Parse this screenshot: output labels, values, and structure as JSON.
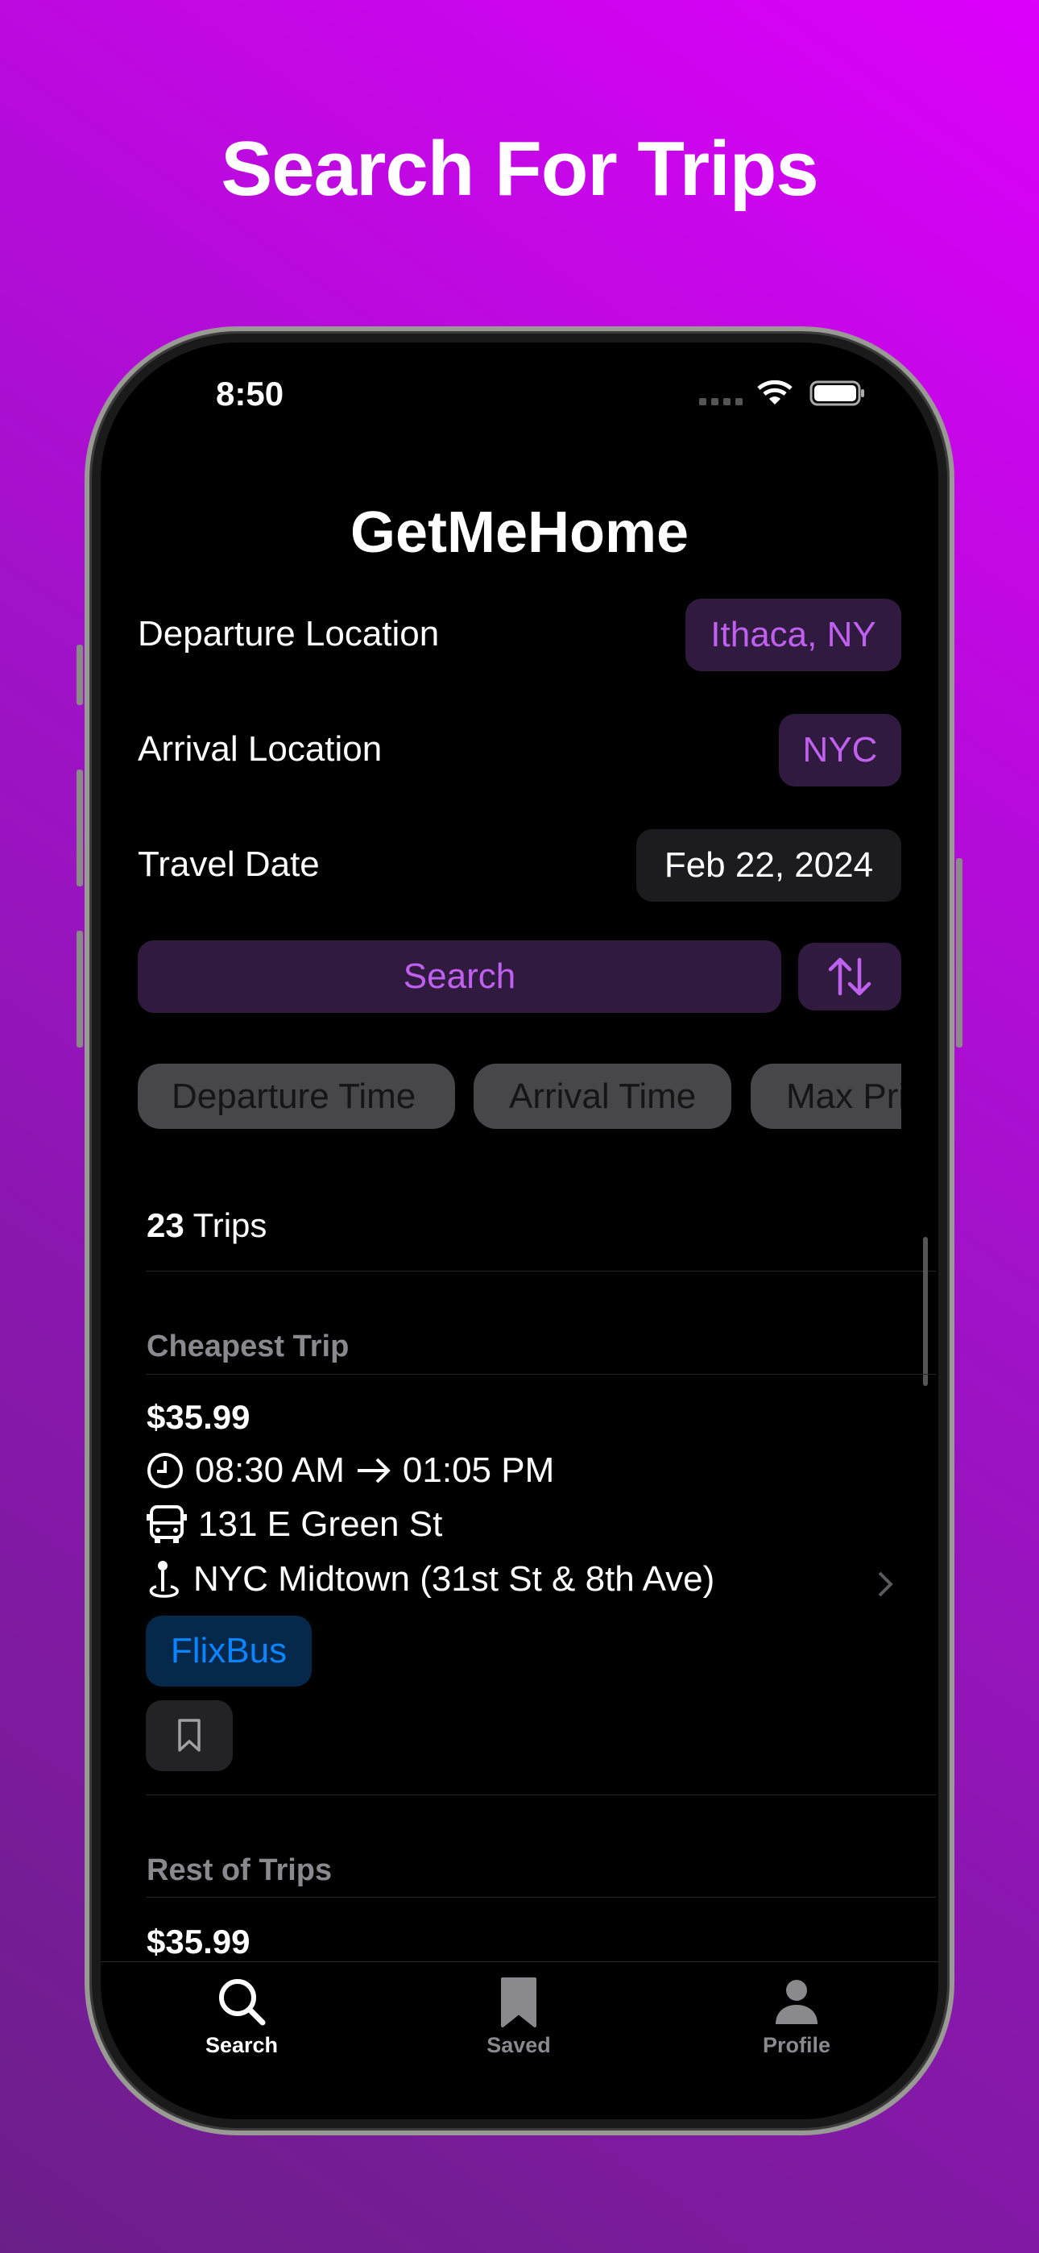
{
  "headline": "Search For Trips",
  "status": {
    "time": "8:50"
  },
  "app": {
    "title": "GetMeHome"
  },
  "form": {
    "departure_label": "Departure Location",
    "departure_value": "Ithaca, NY",
    "arrival_label": "Arrival Location",
    "arrival_value": "NYC",
    "date_label": "Travel Date",
    "date_value": "Feb 22, 2024",
    "search_label": "Search"
  },
  "filters": [
    "Departure Time",
    "Arrival Time",
    "Max Price"
  ],
  "results": {
    "count": "23",
    "count_suffix": "Trips"
  },
  "cheapest": {
    "section": "Cheapest Trip",
    "price": "$35.99",
    "depart": "08:30 AM",
    "arrive": "01:05 PM",
    "from": "131 E Green St",
    "to": "NYC Midtown (31st St & 8th Ave)",
    "carrier": "FlixBus"
  },
  "rest": {
    "section": "Rest of Trips",
    "first_price": "$35.99"
  },
  "tabs": [
    {
      "label": "Search",
      "icon": "magnifying-glass",
      "active": true
    },
    {
      "label": "Saved",
      "icon": "bookmark"
    },
    {
      "label": "Profile",
      "icon": "person"
    }
  ],
  "colors": {
    "accent": "#c060ee",
    "accent_bg": "#311a3f",
    "carrier": "#0a84ff"
  }
}
